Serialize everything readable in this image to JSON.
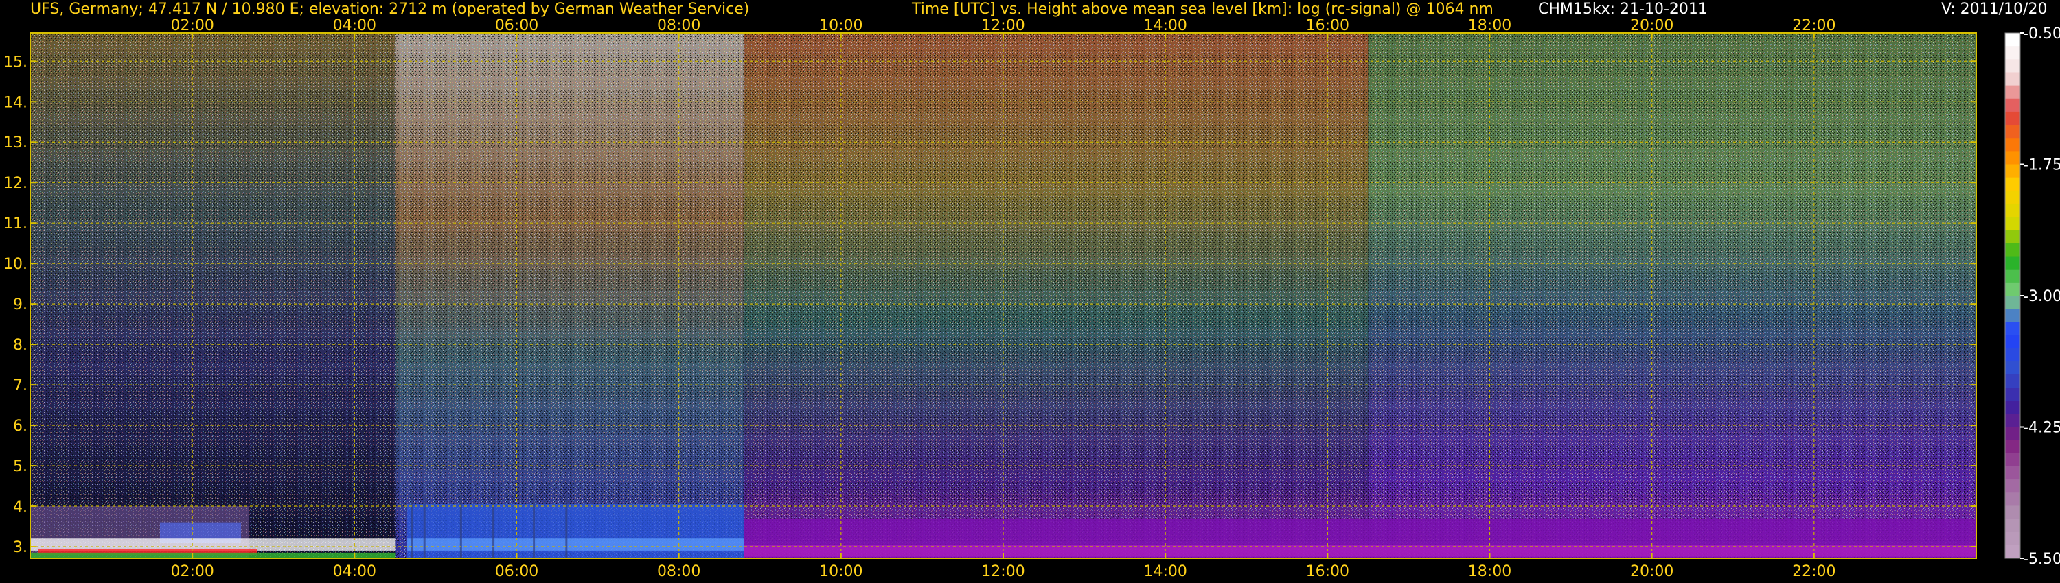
{
  "header": {
    "station": "UFS, Germany; 47.417 N / 10.980 E; elevation: 2712 m  (operated by German Weather Service)",
    "axis_desc": "Time [UTC] vs. Height above mean sea level [km]: log (rc-signal) @ 1064 nm",
    "instrument": "CHM15kx: 21-10-2011",
    "version": "V: 2011/10/20"
  },
  "colors": {
    "text": "#ffd21a",
    "grid": "#c8b400",
    "axis": "#d8c000",
    "background": "#000000"
  },
  "chart_data": {
    "type": "heatmap",
    "title": "Time [UTC] vs. Height above mean sea level [km]: log (rc-signal) @ 1064 nm",
    "x_ticks": [
      "02:00",
      "04:00",
      "06:00",
      "08:00",
      "10:00",
      "12:00",
      "14:00",
      "16:00",
      "18:00",
      "20:00",
      "22:00"
    ],
    "x_hours": [
      2,
      4,
      6,
      8,
      10,
      12,
      14,
      16,
      18,
      20,
      22
    ],
    "xlim_hours": [
      0,
      24
    ],
    "y_ticks": [
      "3.",
      "4.",
      "5.",
      "6.",
      "7.",
      "8.",
      "9.",
      "10.",
      "11.",
      "12.",
      "13.",
      "14.",
      "15."
    ],
    "y_values": [
      3,
      4,
      5,
      6,
      7,
      8,
      9,
      10,
      11,
      12,
      13,
      14,
      15
    ],
    "ylim_km": [
      2.712,
      15.7
    ],
    "grid": true,
    "colorbar": {
      "ticks": [
        "-0.50",
        "-1.75",
        "-3.00",
        "-4.25",
        "-5.50"
      ],
      "tick_values": [
        -0.5,
        -1.75,
        -3.0,
        -4.25,
        -5.5
      ],
      "range": [
        -5.5,
        -0.5
      ],
      "colors": [
        "#ffffff",
        "#f2dcdc",
        "#e04040",
        "#ff8000",
        "#ffd000",
        "#d8d800",
        "#20b020",
        "#80d080",
        "#2040ff",
        "#3050d0",
        "#4020a0",
        "#802080",
        "#a060a0",
        "#b090b0",
        "#c0a0c0"
      ]
    },
    "regimes": [
      {
        "start_hour": 0.0,
        "end_hour": 4.5,
        "low_signal_top_km": 7.0,
        "noise_colors": [
          "#40305a",
          "#5a4040",
          "#50406a"
        ]
      },
      {
        "start_hour": 4.5,
        "end_hour": 8.8,
        "low_signal_top_km": 4.0,
        "noise_colors": [
          "#e0e0e0",
          "#c0a080",
          "#60a0a0"
        ]
      },
      {
        "start_hour": 8.8,
        "end_hour": 16.5,
        "low_signal_top_km": 5.0,
        "noise_colors": [
          "#c06040",
          "#80a050",
          "#4060c0"
        ]
      },
      {
        "start_hour": 16.5,
        "end_hour": 24.0,
        "low_signal_top_km": 6.0,
        "noise_colors": [
          "#60c080",
          "#a0b040",
          "#5040c0"
        ]
      }
    ]
  }
}
